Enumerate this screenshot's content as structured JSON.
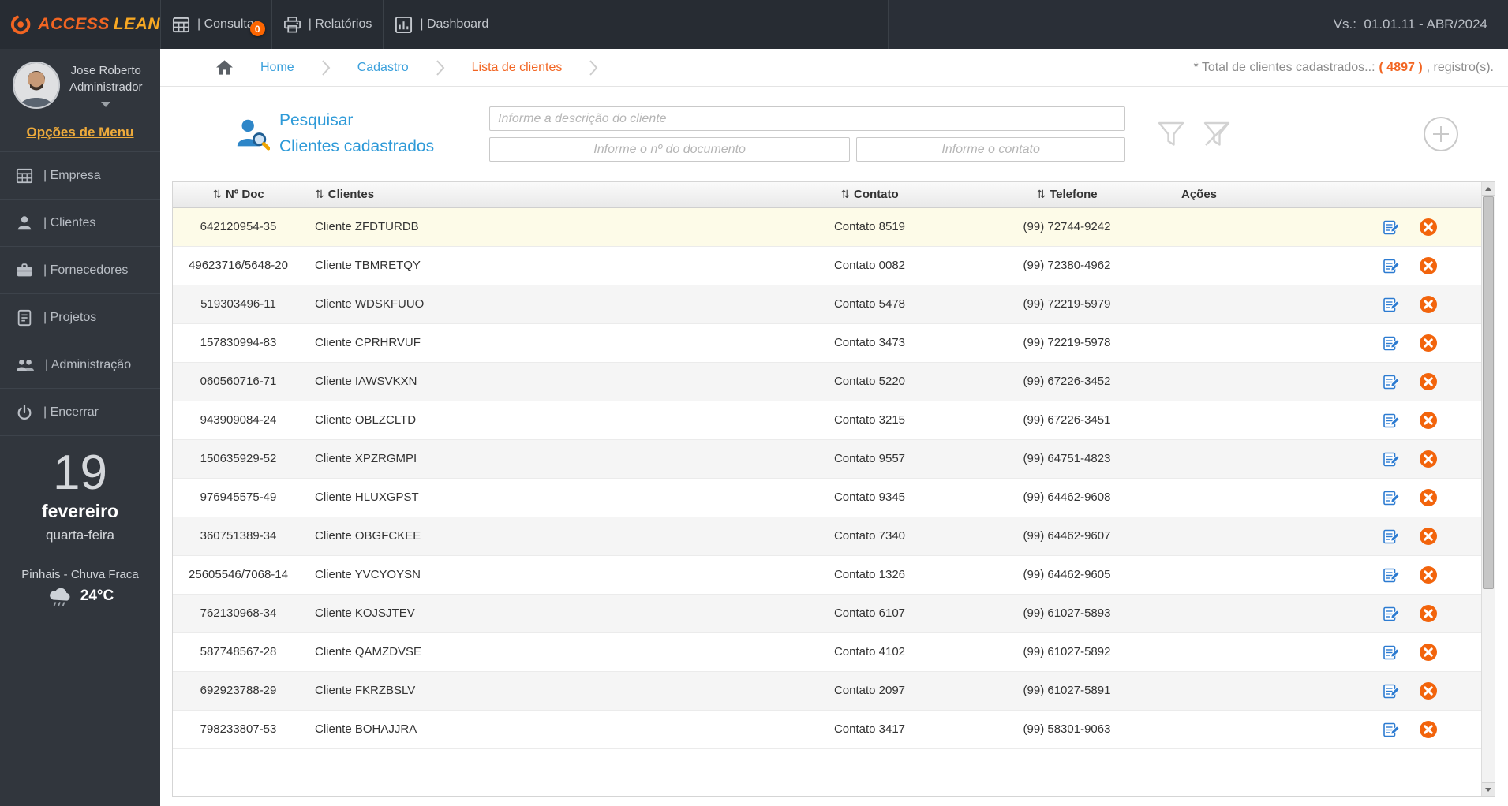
{
  "colors": {
    "accent_orange": "#f26522",
    "badge_orange": "#fd6500",
    "link_blue": "#3aa0dc",
    "title_blue": "#2e9ad8",
    "menu_gold": "#edaa3b",
    "topbar_bg": "#272c33",
    "sidebar_bg": "#31363d",
    "row_highlight": "#fdfbe8",
    "edit_blue": "#2c7bd1",
    "delete_orange": "#f2640c"
  },
  "topbar": {
    "logo": {
      "part1": "ACCESS",
      "part2": "LEAN",
      "icon": "orange-swirl-logo-icon"
    },
    "nav": [
      {
        "label": "| Consultas",
        "icon": "consultas-grid-icon",
        "badge": "0"
      },
      {
        "label": "| Relatórios",
        "icon": "printer-icon"
      },
      {
        "label": "| Dashboard",
        "icon": "dashboard-chart-icon"
      }
    ],
    "version": "Vs.:  01.01.11 - ABR/2024"
  },
  "sidebar": {
    "user": {
      "name": "Jose Roberto",
      "role": "Administrador"
    },
    "menu_title": "Opções de Menu",
    "items": [
      {
        "label": "| Empresa",
        "icon": "company-grid-icon"
      },
      {
        "label": "| Clientes",
        "icon": "person-icon"
      },
      {
        "label": "| Fornecedores",
        "icon": "briefcase-icon"
      },
      {
        "label": "| Projetos",
        "icon": "document-icon"
      },
      {
        "label": "| Administração",
        "icon": "admin-users-icon"
      },
      {
        "label": "| Encerrar",
        "icon": "power-icon"
      }
    ],
    "calendar": {
      "day": "19",
      "month": "fevereiro",
      "weekday": "quarta-feira"
    },
    "weather": {
      "location": "Pinhais - Chuva Fraca",
      "temperature": "24°C",
      "icon": "rain-cloud-icon"
    }
  },
  "breadcrumb": {
    "items": [
      {
        "label": "Home",
        "state": "link"
      },
      {
        "label": "Cadastro",
        "state": "link"
      },
      {
        "label": "Lista de clientes",
        "state": "current"
      }
    ],
    "total_prefix": "* Total de clientes cadastrados..:",
    "total_value": "( 4897 )",
    "total_suffix": ", registro(s)."
  },
  "search": {
    "title_line1": "Pesquisar",
    "title_line2": "Clientes cadastrados",
    "description_placeholder": "Informe a descrição do cliente",
    "document_placeholder": "Informe o nº do documento",
    "contact_placeholder": "Informe o contato"
  },
  "table": {
    "sort_glyph": "⇅",
    "headers": [
      "Nº Doc",
      "Clientes",
      "Contato",
      "Telefone",
      "Ações"
    ],
    "rows": [
      {
        "doc": "642120954-35",
        "client": "Cliente ZFDTURDB",
        "contact": "Contato 8519",
        "phone": "(99) 72744-9242",
        "highlighted": true
      },
      {
        "doc": "49623716/5648-20",
        "client": "Cliente TBMRETQY",
        "contact": "Contato 0082",
        "phone": "(99) 72380-4962"
      },
      {
        "doc": "519303496-11",
        "client": "Cliente WDSKFUUO",
        "contact": "Contato 5478",
        "phone": "(99) 72219-5979"
      },
      {
        "doc": "157830994-83",
        "client": "Cliente CPRHRVUF",
        "contact": "Contato 3473",
        "phone": "(99) 72219-5978"
      },
      {
        "doc": "060560716-71",
        "client": "Cliente IAWSVKXN",
        "contact": "Contato 5220",
        "phone": "(99) 67226-3452"
      },
      {
        "doc": "943909084-24",
        "client": "Cliente OBLZCLTD",
        "contact": "Contato 3215",
        "phone": "(99) 67226-3451"
      },
      {
        "doc": "150635929-52",
        "client": "Cliente XPZRGMPI",
        "contact": "Contato 9557",
        "phone": "(99) 64751-4823"
      },
      {
        "doc": "976945575-49",
        "client": "Cliente HLUXGPST",
        "contact": "Contato 9345",
        "phone": "(99) 64462-9608"
      },
      {
        "doc": "360751389-34",
        "client": "Cliente OBGFCKEE",
        "contact": "Contato 7340",
        "phone": "(99) 64462-9607"
      },
      {
        "doc": "25605546/7068-14",
        "client": "Cliente YVCYOYSN",
        "contact": "Contato 1326",
        "phone": "(99) 64462-9605"
      },
      {
        "doc": "762130968-34",
        "client": "Cliente KOJSJTEV",
        "contact": "Contato 6107",
        "phone": "(99) 61027-5893"
      },
      {
        "doc": "587748567-28",
        "client": "Cliente QAMZDVSE",
        "contact": "Contato 4102",
        "phone": "(99) 61027-5892"
      },
      {
        "doc": "692923788-29",
        "client": "Cliente FKRZBSLV",
        "contact": "Contato 2097",
        "phone": "(99) 61027-5891"
      },
      {
        "doc": "798233807-53",
        "client": "Cliente BOHAJJRA",
        "contact": "Contato 3417",
        "phone": "(99) 58301-9063"
      }
    ]
  }
}
